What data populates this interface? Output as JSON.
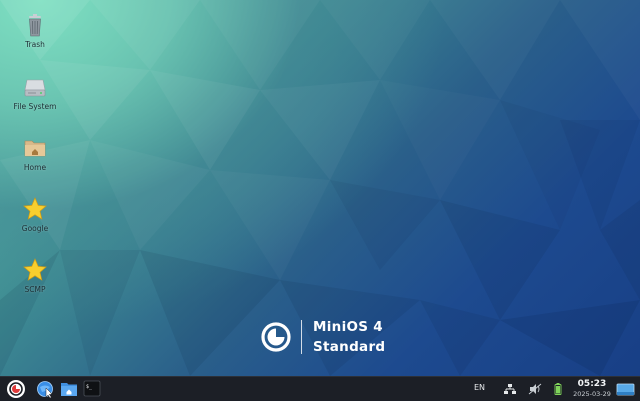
{
  "desktop": {
    "icons": [
      {
        "label": "Trash",
        "icon": "trash-icon"
      },
      {
        "label": "File System",
        "icon": "drive-icon"
      },
      {
        "label": "Home",
        "icon": "home-folder-icon"
      },
      {
        "label": "Google",
        "icon": "star-icon"
      },
      {
        "label": "SCMP",
        "icon": "star-icon"
      }
    ]
  },
  "branding": {
    "name": "MiniOS 4",
    "edition": "Standard"
  },
  "taskbar": {
    "launchers": [
      {
        "name": "menu",
        "icon": "minios-logo-icon"
      },
      {
        "name": "browser",
        "icon": "browser-icon"
      },
      {
        "name": "files",
        "icon": "file-manager-icon"
      },
      {
        "name": "terminal",
        "icon": "terminal-icon",
        "glyph": "$_"
      }
    ],
    "tray": {
      "language": "EN",
      "network_icon": "network-icon",
      "volume_icon": "volume-muted-icon",
      "battery_icon": "battery-icon",
      "show_desktop_icon": "show-desktop-icon"
    },
    "clock": {
      "time": "05:23",
      "date": "2025-03-29"
    }
  },
  "colors": {
    "taskbar": "#1c1f26",
    "desktop_top_left": "#7fe0c2",
    "desktop_bottom_right": "#183f86"
  }
}
